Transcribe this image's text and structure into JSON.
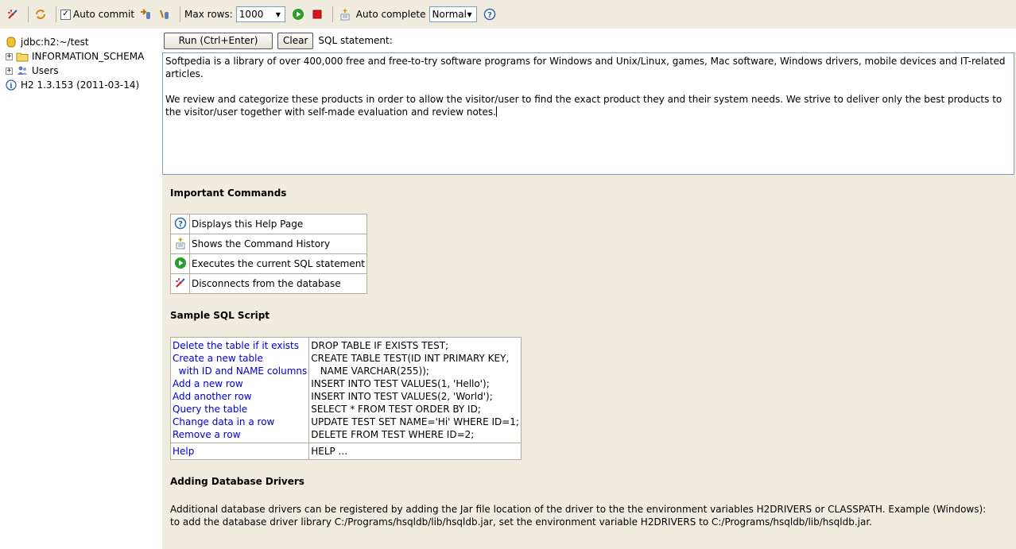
{
  "toolbar": {
    "auto_commit_label": "Auto commit",
    "auto_commit_checked": true,
    "max_rows_label": "Max rows:",
    "max_rows_value": "1000",
    "auto_complete_label": "Auto complete",
    "auto_complete_value": "Normal"
  },
  "tree": {
    "connection": "jdbc:h2:~/test",
    "items": [
      {
        "label": "INFORMATION_SCHEMA",
        "icon": "folder-icon"
      },
      {
        "label": "Users",
        "icon": "users-icon"
      }
    ],
    "version": "H2 1.3.153 (2011-03-14)"
  },
  "query": {
    "run_label": "Run (Ctrl+Enter)",
    "clear_label": "Clear",
    "sql_label": "SQL statement:",
    "text_p1": "Softpedia is a library of over 400,000 free and free-to-try software programs for Windows and Unix/Linux, games, Mac software, Windows drivers, mobile devices and IT-related articles.",
    "text_p2": "We review and categorize these products in order to allow the visitor/user to find the exact product they and their system needs. We strive to deliver only the best products to the visitor/user together with self-made evaluation and review notes."
  },
  "help": {
    "important_title": "Important Commands",
    "commands": [
      {
        "icon": "help-icon",
        "label": "Displays this Help Page"
      },
      {
        "icon": "history-icon",
        "label": "Shows the Command History"
      },
      {
        "icon": "run-icon",
        "label": "Executes the current SQL statement"
      },
      {
        "icon": "disconnect-icon",
        "label": "Disconnects from the database"
      }
    ],
    "sample_title": "Sample SQL Script",
    "sample_left": "Delete the table if it exists\nCreate a new table\n  with ID and NAME columns\nAdd a new row\nAdd another row\nQuery the table\nChange data in a row\nRemove a row",
    "sample_right": "DROP TABLE IF EXISTS TEST;\nCREATE TABLE TEST(ID INT PRIMARY KEY,\n   NAME VARCHAR(255));\nINSERT INTO TEST VALUES(1, 'Hello');\nINSERT INTO TEST VALUES(2, 'World');\nSELECT * FROM TEST ORDER BY ID;\nUPDATE TEST SET NAME='Hi' WHERE ID=1;\nDELETE FROM TEST WHERE ID=2;",
    "help_left": "Help",
    "help_right": "HELP ...",
    "drivers_title": "Adding Database Drivers",
    "drivers_text": "Additional database drivers can be registered by adding the Jar file location of the driver to the the environment variables H2DRIVERS or CLASSPATH. Example (Windows): to add the database driver library C:/Programs/hsqldb/lib/hsqldb.jar, set the environment variable H2DRIVERS to C:/Programs/hsqldb/lib/hsqldb.jar."
  },
  "colors": {
    "background": "#f0ede0",
    "link": "#0000cc",
    "run_green": "#2a9d2a",
    "stop_red": "#d01818"
  }
}
